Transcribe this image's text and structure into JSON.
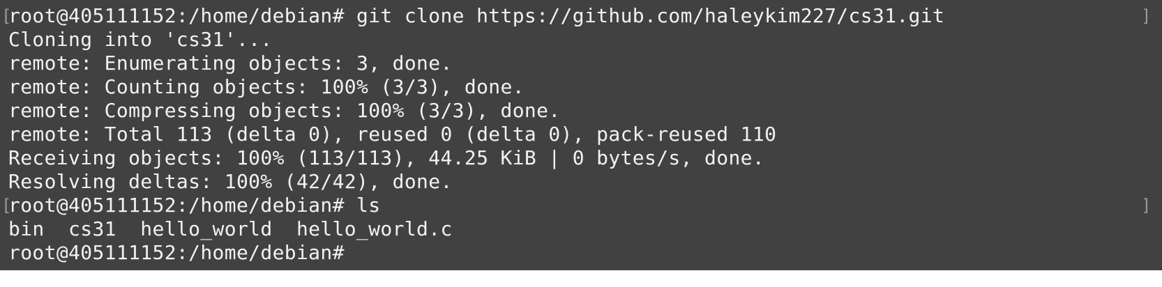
{
  "terminal": {
    "lines": [
      "root@405111152:/home/debian# git clone https://github.com/haleykim227/cs31.git",
      "Cloning into 'cs31'...",
      "remote: Enumerating objects: 3, done.",
      "remote: Counting objects: 100% (3/3), done.",
      "remote: Compressing objects: 100% (3/3), done.",
      "remote: Total 113 (delta 0), reused 0 (delta 0), pack-reused 110",
      "Receiving objects: 100% (113/113), 44.25 KiB | 0 bytes/s, done.",
      "Resolving deltas: 100% (42/42), done.",
      "root@405111152:/home/debian# ls",
      "bin  cs31  hello_world  hello_world.c",
      "root@405111152:/home/debian#"
    ]
  },
  "colors": {
    "background": "#414141",
    "text": "#f2f2f2"
  }
}
